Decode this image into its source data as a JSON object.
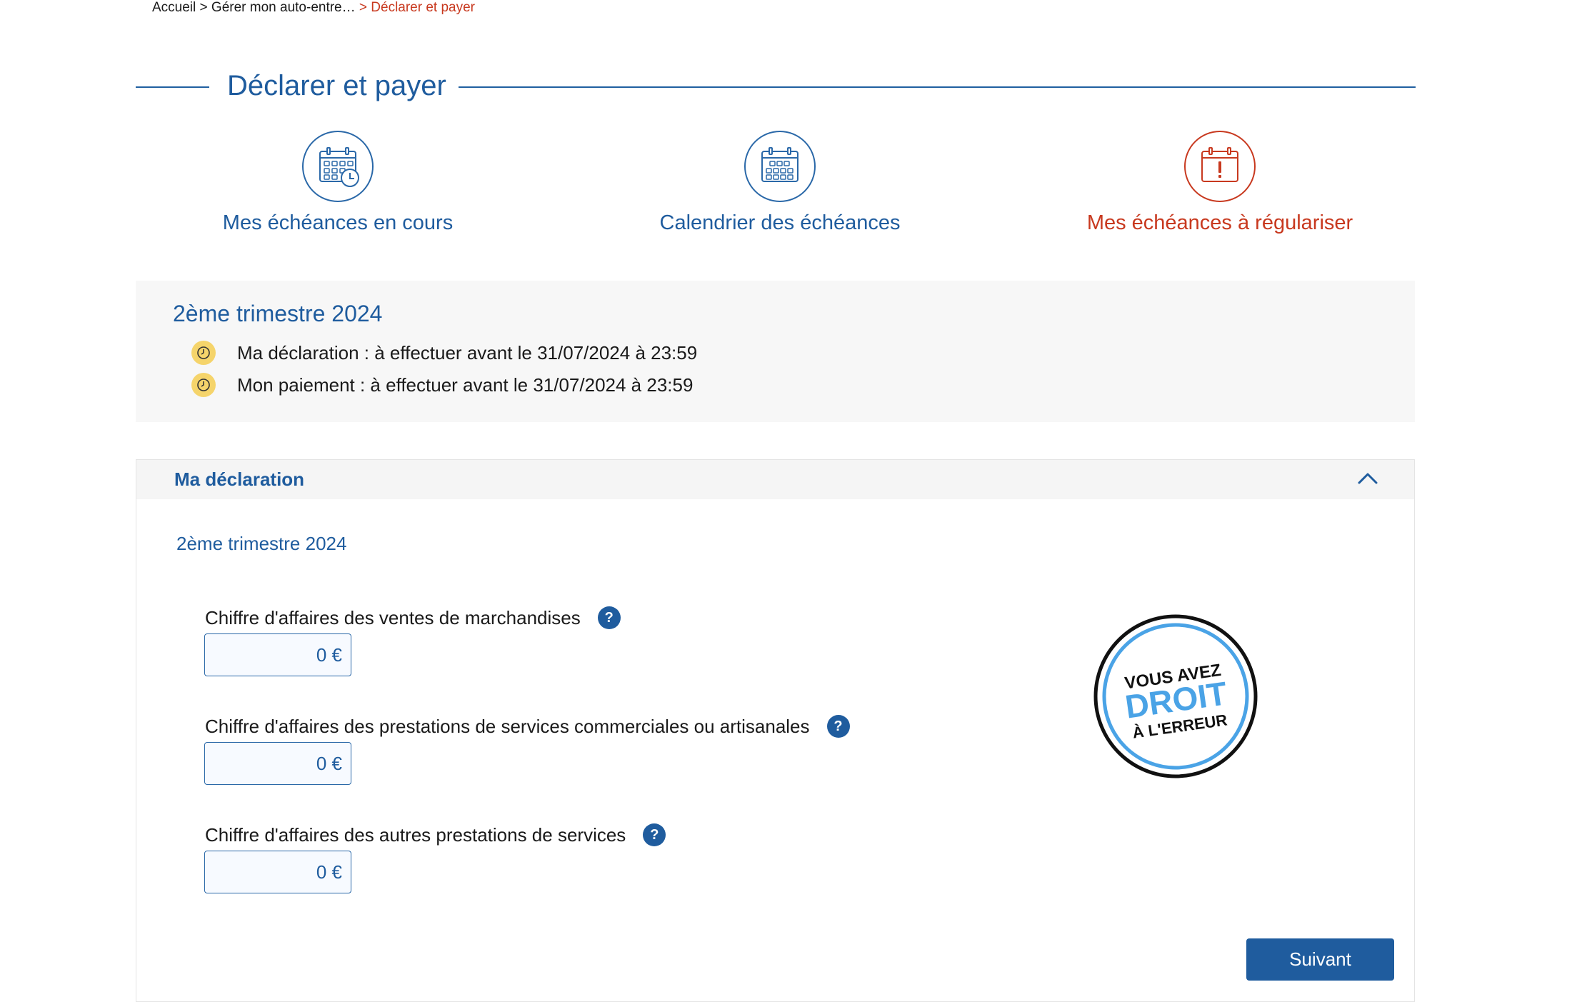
{
  "breadcrumb": {
    "home": "Accueil",
    "separator": ">",
    "section": "Gérer mon auto-entre…",
    "current": "> Déclarer et payer"
  },
  "page": {
    "title": "Déclarer et payer"
  },
  "nav_tiles": [
    {
      "label": "Mes échéances en cours",
      "icon": "calendar-clock-icon"
    },
    {
      "label": "Calendrier des échéances",
      "icon": "calendar-icon"
    },
    {
      "label": "Mes échéances à régulariser",
      "icon": "calendar-alert-icon"
    }
  ],
  "summary": {
    "title": "2ème trimestre 2024",
    "items": [
      "Ma déclaration : à effectuer avant le 31/07/2024 à 23:59",
      "Mon paiement : à effectuer avant le 31/07/2024 à 23:59"
    ]
  },
  "declaration": {
    "header": "Ma déclaration",
    "period": "2ème trimestre 2024",
    "fields": [
      {
        "label": "Chiffre d'affaires des ventes de marchandises",
        "value": "0 €"
      },
      {
        "label": "Chiffre d'affaires des prestations de services commerciales ou artisanales",
        "value": "0 €"
      },
      {
        "label": "Chiffre d'affaires des autres prestations de services",
        "value": "0 €"
      }
    ],
    "help_symbol": "?",
    "badge": {
      "line1": "VOUS AVEZ",
      "line2": "DROIT",
      "line3": "À L'ERREUR"
    },
    "next_button": "Suivant"
  },
  "colors": {
    "primary": "#1f5c9e",
    "alert": "#c8391f",
    "clock_badge": "#f5d46b",
    "badge_accent": "#4aa3e6"
  }
}
